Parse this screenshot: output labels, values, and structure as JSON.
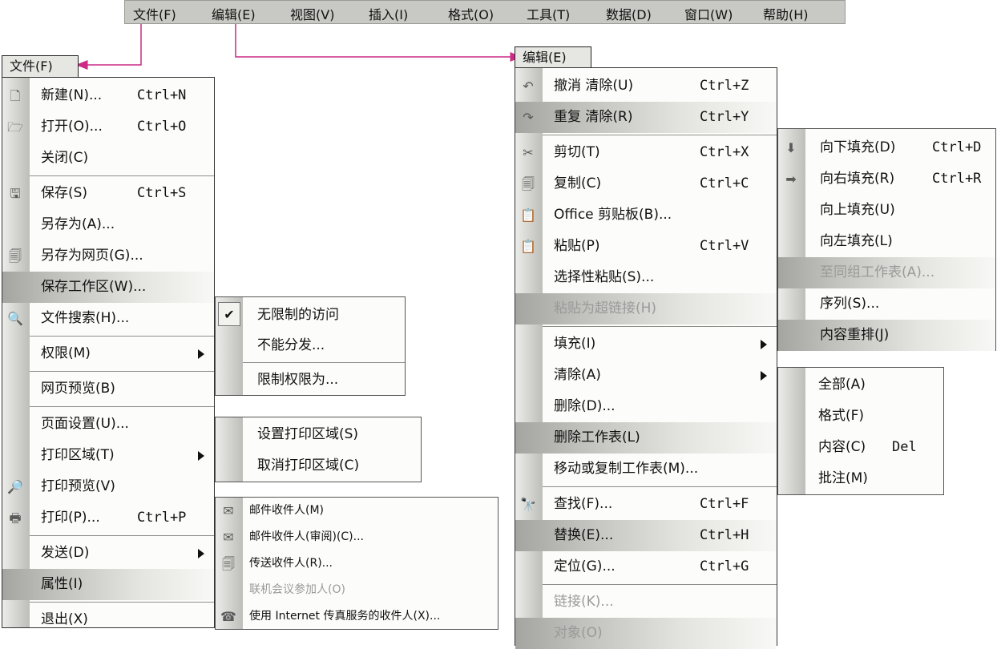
{
  "menubar": {
    "items": [
      "文件(F)",
      "编辑(E)",
      "视图(V)",
      "插入(I)",
      "格式(O)",
      "工具(T)",
      "数据(D)",
      "窗口(W)",
      "帮助(H)"
    ]
  },
  "colors": {
    "pointer": "#cc2a86",
    "border": "#222222",
    "gutter": "#c8c8c4"
  },
  "file_menu": {
    "title": "文件(F)",
    "items": [
      {
        "icon": "new-document-icon",
        "label": "新建(N)...",
        "shortcut": "Ctrl+N"
      },
      {
        "icon": "open-folder-icon",
        "label": "打开(O)...",
        "shortcut": "Ctrl+O"
      },
      {
        "icon": "",
        "label": "关闭(C)",
        "shortcut": ""
      },
      {
        "icon": "save-icon",
        "label": "保存(S)",
        "shortcut": "Ctrl+S"
      },
      {
        "icon": "",
        "label": "另存为(A)...",
        "shortcut": ""
      },
      {
        "icon": "save-as-web-page-icon",
        "label": "另存为网页(G)...",
        "shortcut": ""
      },
      {
        "icon": "",
        "label": "保存工作区(W)...",
        "shortcut": ""
      },
      {
        "icon": "file-search-icon",
        "label": "文件搜索(H)...",
        "shortcut": ""
      },
      {
        "icon": "",
        "label": "权限(M)",
        "shortcut": "",
        "submenu": true
      },
      {
        "icon": "",
        "label": "网页预览(B)",
        "shortcut": ""
      },
      {
        "icon": "",
        "label": "页面设置(U)...",
        "shortcut": ""
      },
      {
        "icon": "",
        "label": "打印区域(T)",
        "shortcut": "",
        "submenu": true
      },
      {
        "icon": "print-preview-icon",
        "label": "打印预览(V)",
        "shortcut": ""
      },
      {
        "icon": "printer-icon",
        "label": "打印(P)...",
        "shortcut": "Ctrl+P"
      },
      {
        "icon": "",
        "label": "发送(D)",
        "shortcut": "",
        "submenu": true
      },
      {
        "icon": "",
        "label": "属性(I)",
        "shortcut": ""
      },
      {
        "icon": "",
        "label": "退出(X)",
        "shortcut": ""
      }
    ]
  },
  "permission_submenu": {
    "items": [
      {
        "label": "无限制的访问",
        "checked": true
      },
      {
        "label": "不能分发..."
      },
      {
        "label": "限制权限为..."
      }
    ]
  },
  "print_area_submenu": {
    "items": [
      {
        "label": "设置打印区域(S)"
      },
      {
        "label": "取消打印区域(C)"
      }
    ]
  },
  "send_submenu": {
    "items": [
      {
        "icon": "mail-recipient-icon",
        "label": "邮件收件人(M)"
      },
      {
        "icon": "mail-review-icon",
        "label": "邮件收件人(审阅)(C)..."
      },
      {
        "icon": "routing-recipient-icon",
        "label": "传送收件人(R)..."
      },
      {
        "icon": "",
        "label": "联机会议参加人(O)",
        "disabled": true
      },
      {
        "icon": "internet-fax-icon",
        "label": "使用 Internet 传真服务的收件人(X)..."
      }
    ]
  },
  "edit_menu": {
    "title": "编辑(E)",
    "items": [
      {
        "icon": "undo-icon",
        "label": "撤消 清除(U)",
        "shortcut": "Ctrl+Z"
      },
      {
        "icon": "redo-icon",
        "label": "重复 清除(R)",
        "shortcut": "Ctrl+Y"
      },
      {
        "icon": "scissors-icon",
        "label": "剪切(T)",
        "shortcut": "Ctrl+X"
      },
      {
        "icon": "copy-icon",
        "label": "复制(C)",
        "shortcut": "Ctrl+C"
      },
      {
        "icon": "clipboard-icon",
        "label": "Office 剪贴板(B)...",
        "shortcut": ""
      },
      {
        "icon": "paste-icon",
        "label": "粘贴(P)",
        "shortcut": "Ctrl+V"
      },
      {
        "icon": "",
        "label": "选择性粘贴(S)...",
        "shortcut": ""
      },
      {
        "icon": "",
        "label": "粘贴为超链接(H)",
        "shortcut": "",
        "disabled": true
      },
      {
        "icon": "",
        "label": "填充(I)",
        "shortcut": "",
        "submenu": true
      },
      {
        "icon": "",
        "label": "清除(A)",
        "shortcut": "",
        "submenu": true
      },
      {
        "icon": "",
        "label": "删除(D)...",
        "shortcut": ""
      },
      {
        "icon": "",
        "label": "删除工作表(L)",
        "shortcut": ""
      },
      {
        "icon": "",
        "label": "移动或复制工作表(M)...",
        "shortcut": ""
      },
      {
        "icon": "binoculars-icon",
        "label": "查找(F)...",
        "shortcut": "Ctrl+F"
      },
      {
        "icon": "",
        "label": "替换(E)...",
        "shortcut": "Ctrl+H"
      },
      {
        "icon": "",
        "label": "定位(G)...",
        "shortcut": "Ctrl+G"
      },
      {
        "icon": "",
        "label": "链接(K)...",
        "shortcut": "",
        "disabled": true
      },
      {
        "icon": "",
        "label": "对象(O)",
        "shortcut": "",
        "disabled": true
      }
    ]
  },
  "fill_submenu": {
    "items": [
      {
        "icon": "fill-down-icon",
        "label": "向下填充(D)",
        "shortcut": "Ctrl+D"
      },
      {
        "icon": "fill-right-icon",
        "label": "向右填充(R)",
        "shortcut": "Ctrl+R"
      },
      {
        "icon": "",
        "label": "向上填充(U)",
        "shortcut": ""
      },
      {
        "icon": "",
        "label": "向左填充(L)",
        "shortcut": ""
      },
      {
        "icon": "",
        "label": "至同组工作表(A)...",
        "shortcut": "",
        "disabled": true
      },
      {
        "icon": "",
        "label": "序列(S)...",
        "shortcut": ""
      },
      {
        "icon": "",
        "label": "内容重排(J)",
        "shortcut": ""
      }
    ]
  },
  "clear_submenu": {
    "items": [
      {
        "label": "全部(A)",
        "shortcut": ""
      },
      {
        "label": "格式(F)",
        "shortcut": ""
      },
      {
        "label": "内容(C)",
        "shortcut": "Del"
      },
      {
        "label": "批注(M)",
        "shortcut": ""
      }
    ]
  }
}
